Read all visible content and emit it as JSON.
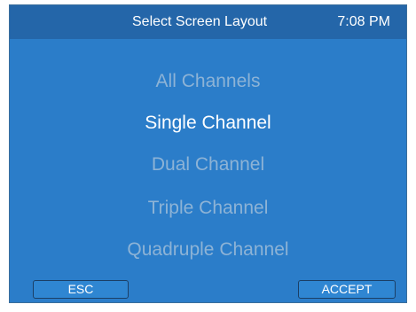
{
  "header": {
    "title": "Select Screen Layout",
    "time": "7:08 PM"
  },
  "layout_options": [
    {
      "label": "All Channels",
      "selected": false
    },
    {
      "label": "Single Channel",
      "selected": true
    },
    {
      "label": "Dual Channel",
      "selected": false
    },
    {
      "label": "Triple Channel",
      "selected": false
    },
    {
      "label": "Quadruple Channel",
      "selected": false
    }
  ],
  "buttons": {
    "esc_label": "ESC",
    "accept_label": "ACCEPT"
  },
  "colors": {
    "background": "#2b7dc9",
    "header": "#2466a9",
    "selected_text": "#ffffff",
    "unselected_text": "#8db3d6"
  }
}
